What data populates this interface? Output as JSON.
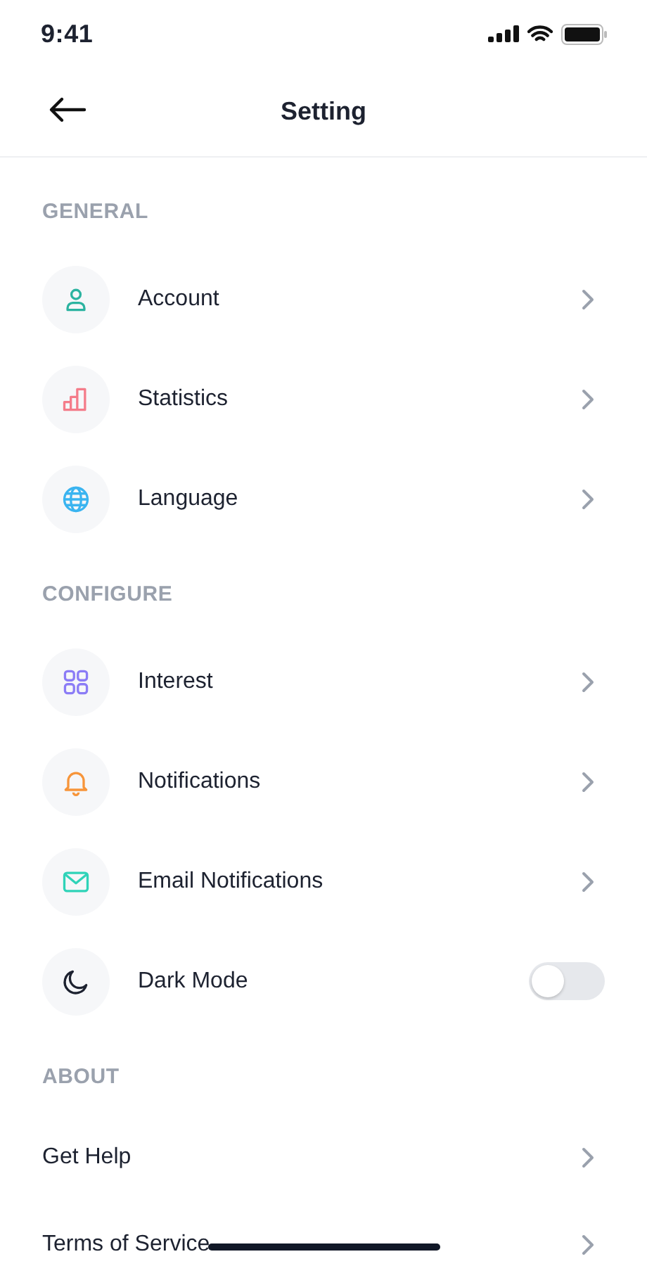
{
  "status_bar": {
    "time": "9:41"
  },
  "header": {
    "title": "Setting"
  },
  "sections": [
    {
      "title": "GENERAL",
      "items": [
        {
          "kind": "link",
          "label": "Account"
        },
        {
          "kind": "link",
          "label": "Statistics"
        },
        {
          "kind": "link",
          "label": "Language"
        }
      ]
    },
    {
      "title": "CONFIGURE",
      "items": [
        {
          "kind": "link",
          "label": "Interest"
        },
        {
          "kind": "link",
          "label": "Notifications"
        },
        {
          "kind": "link",
          "label": "Email Notifications"
        },
        {
          "kind": "toggle",
          "label": "Dark Mode",
          "on": false
        }
      ]
    },
    {
      "title": "ABOUT",
      "items": [
        {
          "kind": "plain",
          "label": "Get Help"
        },
        {
          "kind": "plain",
          "label": "Terms of Service"
        }
      ]
    }
  ]
}
